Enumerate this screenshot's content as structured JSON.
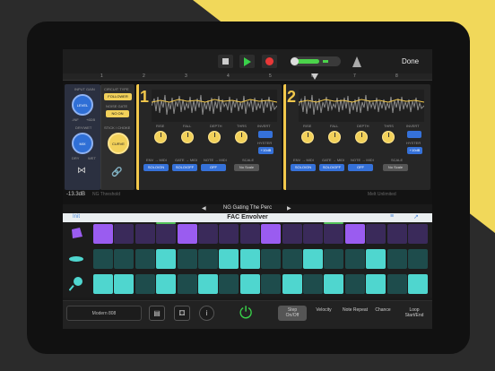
{
  "transport": {
    "done_label": "Done"
  },
  "ruler": {
    "bars": [
      "1",
      "2",
      "3",
      "4",
      "5",
      "6",
      "7",
      "8"
    ]
  },
  "plugin": {
    "main": {
      "input_gain_label": "INPUT GAIN",
      "level_label": "LEVEL",
      "level_range": [
        "-INF",
        "+6dB"
      ],
      "dry_wet_label": "DRY/WET",
      "mix_label": "MIX",
      "mix_range": [
        "DRY",
        "WET"
      ]
    },
    "circuit": {
      "type_label": "CIRCUIT TYPE",
      "type_value": "FOLLOWER",
      "noise_gate_label": "NOISE GATE",
      "noise_gate_value": "NO ON",
      "stick_label": "STICK / CHOKE",
      "curve_label": "CURVE"
    },
    "env1": {
      "number": "1",
      "knobs": [
        "RISE",
        "FALL",
        "DEPTH",
        "THRS"
      ],
      "invert_label": "INVERT",
      "hyster_label": "HYSTER",
      "hyster_value": "+10dB",
      "send_labels": [
        "ENV → MIDI",
        "GATE → MIDI",
        "NOTE → MIDI",
        "SCALE"
      ],
      "send_values": [
        "SOLO/ON",
        "SOLO/OFF",
        "OFF",
        "No Scale"
      ]
    },
    "env2": {
      "number": "2",
      "knobs": [
        "RISE",
        "FALL",
        "DEPTH",
        "THRS"
      ],
      "invert_label": "INVERT",
      "hyster_label": "HYSTER",
      "hyster_value": "+10dB",
      "send_labels": [
        "ENV → MIDI",
        "GATE → MIDI",
        "NOTE → MIDI",
        "SCALE"
      ],
      "send_values": [
        "SOLO/ON",
        "SOLO/OFF",
        "OFF",
        "No Scale"
      ]
    },
    "footer_left": "-13.3dB",
    "footer_left_sub": "NG Threshold",
    "footer_right": "Melt Unlimited"
  },
  "preset": {
    "name": "NG Gating The Perc",
    "prev": "◀",
    "next": "▶"
  },
  "plugin_title": {
    "init": "Init",
    "name": "FAC Envolver"
  },
  "grid": {
    "colors": {
      "purple_on": "#9a5cf0",
      "purple_off": "#3a2a5a",
      "teal_on": "#4fd6cf",
      "teal_off": "#1e4c4c",
      "green": "#52c05a"
    },
    "rows": [
      {
        "icon": "cowbell-icon",
        "steps": [
          1,
          0,
          0,
          0,
          1,
          0,
          0,
          0,
          1,
          0,
          0,
          0,
          1,
          0,
          0,
          0
        ]
      },
      {
        "icon": "cymbal-icon",
        "steps": [
          0,
          0,
          0,
          1,
          0,
          0,
          1,
          1,
          0,
          0,
          1,
          0,
          0,
          1,
          0,
          0
        ]
      },
      {
        "icon": "maraca-icon",
        "steps": [
          1,
          1,
          0,
          1,
          0,
          1,
          0,
          1,
          0,
          1,
          0,
          1,
          0,
          1,
          0,
          1
        ]
      }
    ]
  },
  "bottom": {
    "kit": "Modern 808",
    "modes": [
      {
        "label": "Step\nOn/Off",
        "active": true
      },
      {
        "label": "Velocity",
        "active": false
      },
      {
        "label": "Note Repeat",
        "active": false
      },
      {
        "label": "Chance",
        "active": false
      },
      {
        "label": "Loop\nStart/End",
        "active": false
      }
    ]
  }
}
